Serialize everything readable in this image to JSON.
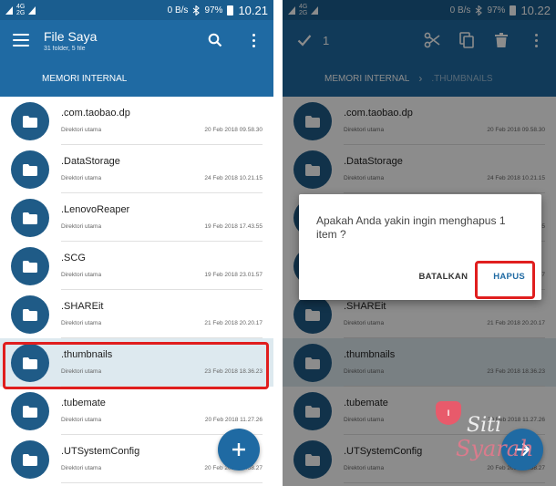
{
  "status": {
    "left": {
      "net_top": "4G",
      "net_bottom": "2G"
    },
    "right": {
      "speed": "0 B/s",
      "battery": "97%",
      "time": "10.21"
    }
  },
  "status_right": {
    "speed": "0 B/s",
    "battery": "97%",
    "time": "10.22"
  },
  "left_screen": {
    "title": "File Saya",
    "subtitle": "31 folder, 5 file",
    "path": "MEMORI INTERNAL"
  },
  "right_screen": {
    "selection_count": "1",
    "path_root": "MEMORI INTERNAL",
    "path_current": ".THUMBNAILS"
  },
  "items": [
    {
      "name": ".com.taobao.dp",
      "sub": "Direktori utama",
      "date": "20 Feb 2018 09.58.30"
    },
    {
      "name": ".DataStorage",
      "sub": "Direktori utama",
      "date": "24 Feb 2018 10.21.15"
    },
    {
      "name": ".LenovoReaper",
      "sub": "Direktori utama",
      "date": "19 Feb 2018 17.43.55"
    },
    {
      "name": ".SCG",
      "sub": "Direktori utama",
      "date": "19 Feb 2018 23.01.57"
    },
    {
      "name": ".SHAREit",
      "sub": "Direktori utama",
      "date": "21 Feb 2018 20.20.17"
    },
    {
      "name": ".thumbnails",
      "sub": "Direktori utama",
      "date": "23 Feb 2018 18.36.23"
    },
    {
      "name": ".tubemate",
      "sub": "Direktori utama",
      "date": "20 Feb 2018 11.27.26"
    },
    {
      "name": ".UTSystemConfig",
      "sub": "Direktori utama",
      "date": "20 Feb 2018 09.58.27"
    }
  ],
  "dialog": {
    "message": "Apakah Anda yakin ingin menghapus 1 item ?",
    "cancel_label": "BATALKAN",
    "confirm_label": "HAPUS"
  },
  "watermark": {
    "heart": "I",
    "line1": "Siti",
    "line2": "Syarah"
  },
  "colors": {
    "primary": "#1f6aa3",
    "status_bar": "#1a5d8f",
    "folder": "#1f5b87",
    "highlight": "#e01e1e",
    "selected_row": "#dde9ef"
  },
  "icons": [
    "menu-icon",
    "search-icon",
    "more-vert-icon",
    "check-icon",
    "cut-icon",
    "copy-icon",
    "delete-icon",
    "add-icon",
    "arrow-forward-icon",
    "folder-icon"
  ]
}
